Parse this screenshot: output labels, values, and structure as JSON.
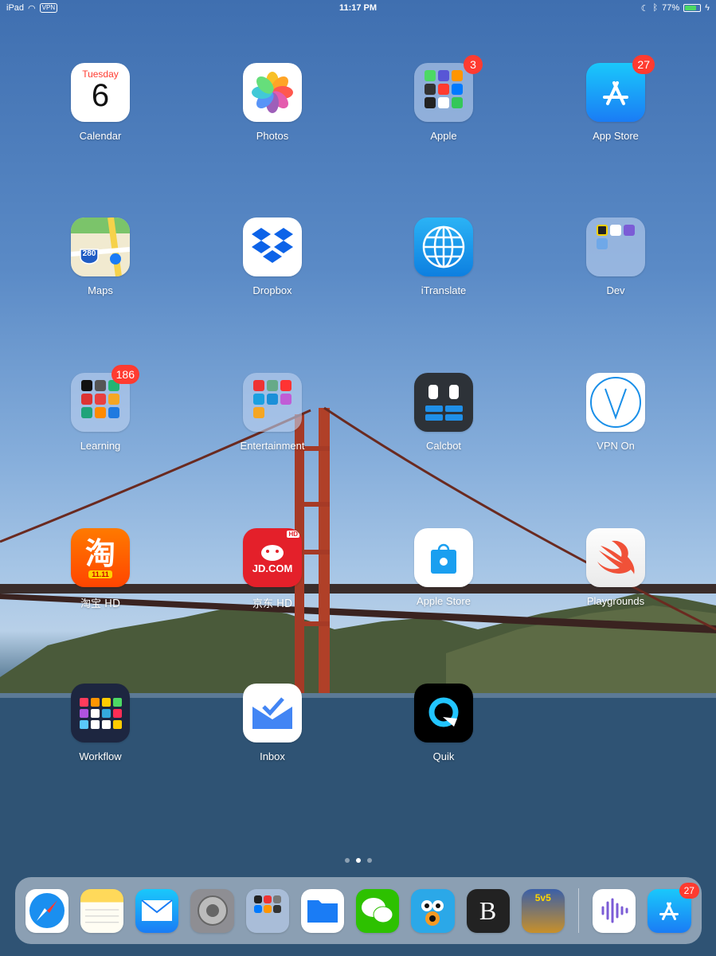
{
  "status_bar": {
    "device": "iPad",
    "vpn": "VPN",
    "time": "11:17 PM",
    "battery": "77%",
    "battery_level": 0.77
  },
  "apps": [
    {
      "name": "Calendar",
      "day": "Tuesday",
      "date": "6"
    },
    {
      "name": "Photos"
    },
    {
      "name": "Apple",
      "badge": "3"
    },
    {
      "name": "App Store",
      "badge": "27"
    },
    {
      "name": "Maps",
      "sign": "280"
    },
    {
      "name": "Dropbox"
    },
    {
      "name": "iTranslate"
    },
    {
      "name": "Dev"
    },
    {
      "name": "Learning",
      "badge": "186"
    },
    {
      "name": "Entertainment"
    },
    {
      "name": "Calcbot"
    },
    {
      "name": "VPN On"
    },
    {
      "name": "淘宝 HD",
      "glyph": "淘",
      "sub": "11.11"
    },
    {
      "name": "京东 HD",
      "text": "JD.COM",
      "corner": "HD"
    },
    {
      "name": "Apple Store"
    },
    {
      "name": "Playgrounds"
    },
    {
      "name": "Workflow"
    },
    {
      "name": "Inbox"
    },
    {
      "name": "Quik"
    }
  ],
  "dock": {
    "apps": [
      {
        "name": "Safari"
      },
      {
        "name": "Notes"
      },
      {
        "name": "Mail"
      },
      {
        "name": "Settings"
      },
      {
        "name": "Folder"
      },
      {
        "name": "Files"
      },
      {
        "name": "WeChat"
      },
      {
        "name": "Tweetbot"
      },
      {
        "name": "Bear",
        "glyph": "B"
      },
      {
        "name": "Game",
        "glyph": "5v5"
      }
    ],
    "recent": [
      {
        "name": "Podcasts"
      },
      {
        "name": "App Store",
        "badge": "27"
      }
    ]
  },
  "pages": {
    "count": 3,
    "current": 2
  },
  "colors": {
    "badge": "#ff3b30",
    "battery": "#4cd964"
  }
}
